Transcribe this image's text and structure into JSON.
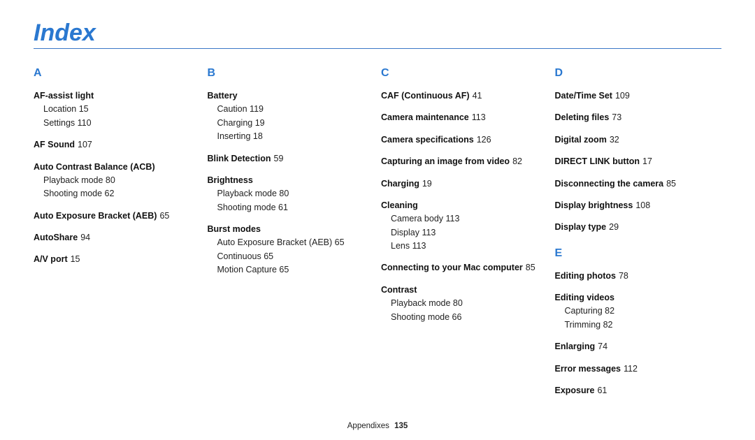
{
  "page_title": "Index",
  "footer": {
    "section": "Appendixes",
    "page": "135"
  },
  "col1": {
    "letter": "A",
    "e0_head": "AF-assist light",
    "e0_sub0": "Location  15",
    "e0_sub1": "Settings  110",
    "e1_head": "AF Sound",
    "e1_pg": "107",
    "e2_head": "Auto Contrast Balance (ACB)",
    "e2_sub0": "Playback mode  80",
    "e2_sub1": "Shooting mode  62",
    "e3_head": "Auto Exposure Bracket (AEB)",
    "e3_pg": "65",
    "e4_head": "AutoShare",
    "e4_pg": "94",
    "e5_head": "A/V port",
    "e5_pg": "15"
  },
  "col2": {
    "letter": "B",
    "e0_head": "Battery",
    "e0_sub0": "Caution  119",
    "e0_sub1": "Charging  19",
    "e0_sub2": "Inserting  18",
    "e1_head": "Blink Detection",
    "e1_pg": "59",
    "e2_head": "Brightness",
    "e2_sub0": "Playback mode  80",
    "e2_sub1": "Shooting mode  61",
    "e3_head": "Burst modes",
    "e3_sub0": "Auto Exposure Bracket (AEB)  65",
    "e3_sub1": "Continuous  65",
    "e3_sub2": "Motion Capture  65"
  },
  "col3": {
    "letter": "C",
    "e0_head": "CAF (Continuous AF)",
    "e0_pg": "41",
    "e1_head": "Camera maintenance",
    "e1_pg": "113",
    "e2_head": "Camera specifications",
    "e2_pg": "126",
    "e3_head": "Capturing an image from video",
    "e3_pg": "82",
    "e4_head": "Charging",
    "e4_pg": "19",
    "e5_head": "Cleaning",
    "e5_sub0": "Camera body  113",
    "e5_sub1": "Display  113",
    "e5_sub2": "Lens  113",
    "e6_head": "Connecting to your Mac computer",
    "e6_pg": "85",
    "e7_head": "Contrast",
    "e7_sub0": "Playback mode  80",
    "e7_sub1": "Shooting mode  66"
  },
  "col4": {
    "letterD": "D",
    "d0_head": "Date/Time Set",
    "d0_pg": "109",
    "d1_head": "Deleting files",
    "d1_pg": "73",
    "d2_head": "Digital zoom",
    "d2_pg": "32",
    "d3_head": "DIRECT LINK button",
    "d3_pg": "17",
    "d4_head": "Disconnecting the camera",
    "d4_pg": "85",
    "d5_head": "Display brightness",
    "d5_pg": "108",
    "d6_head": "Display type",
    "d6_pg": "29",
    "letterE": "E",
    "e0_head": "Editing photos",
    "e0_pg": "78",
    "e1_head": "Editing videos",
    "e1_sub0": "Capturing  82",
    "e1_sub1": "Trimming  82",
    "e2_head": "Enlarging",
    "e2_pg": "74",
    "e3_head": "Error messages",
    "e3_pg": "112",
    "e4_head": "Exposure",
    "e4_pg": "61"
  }
}
